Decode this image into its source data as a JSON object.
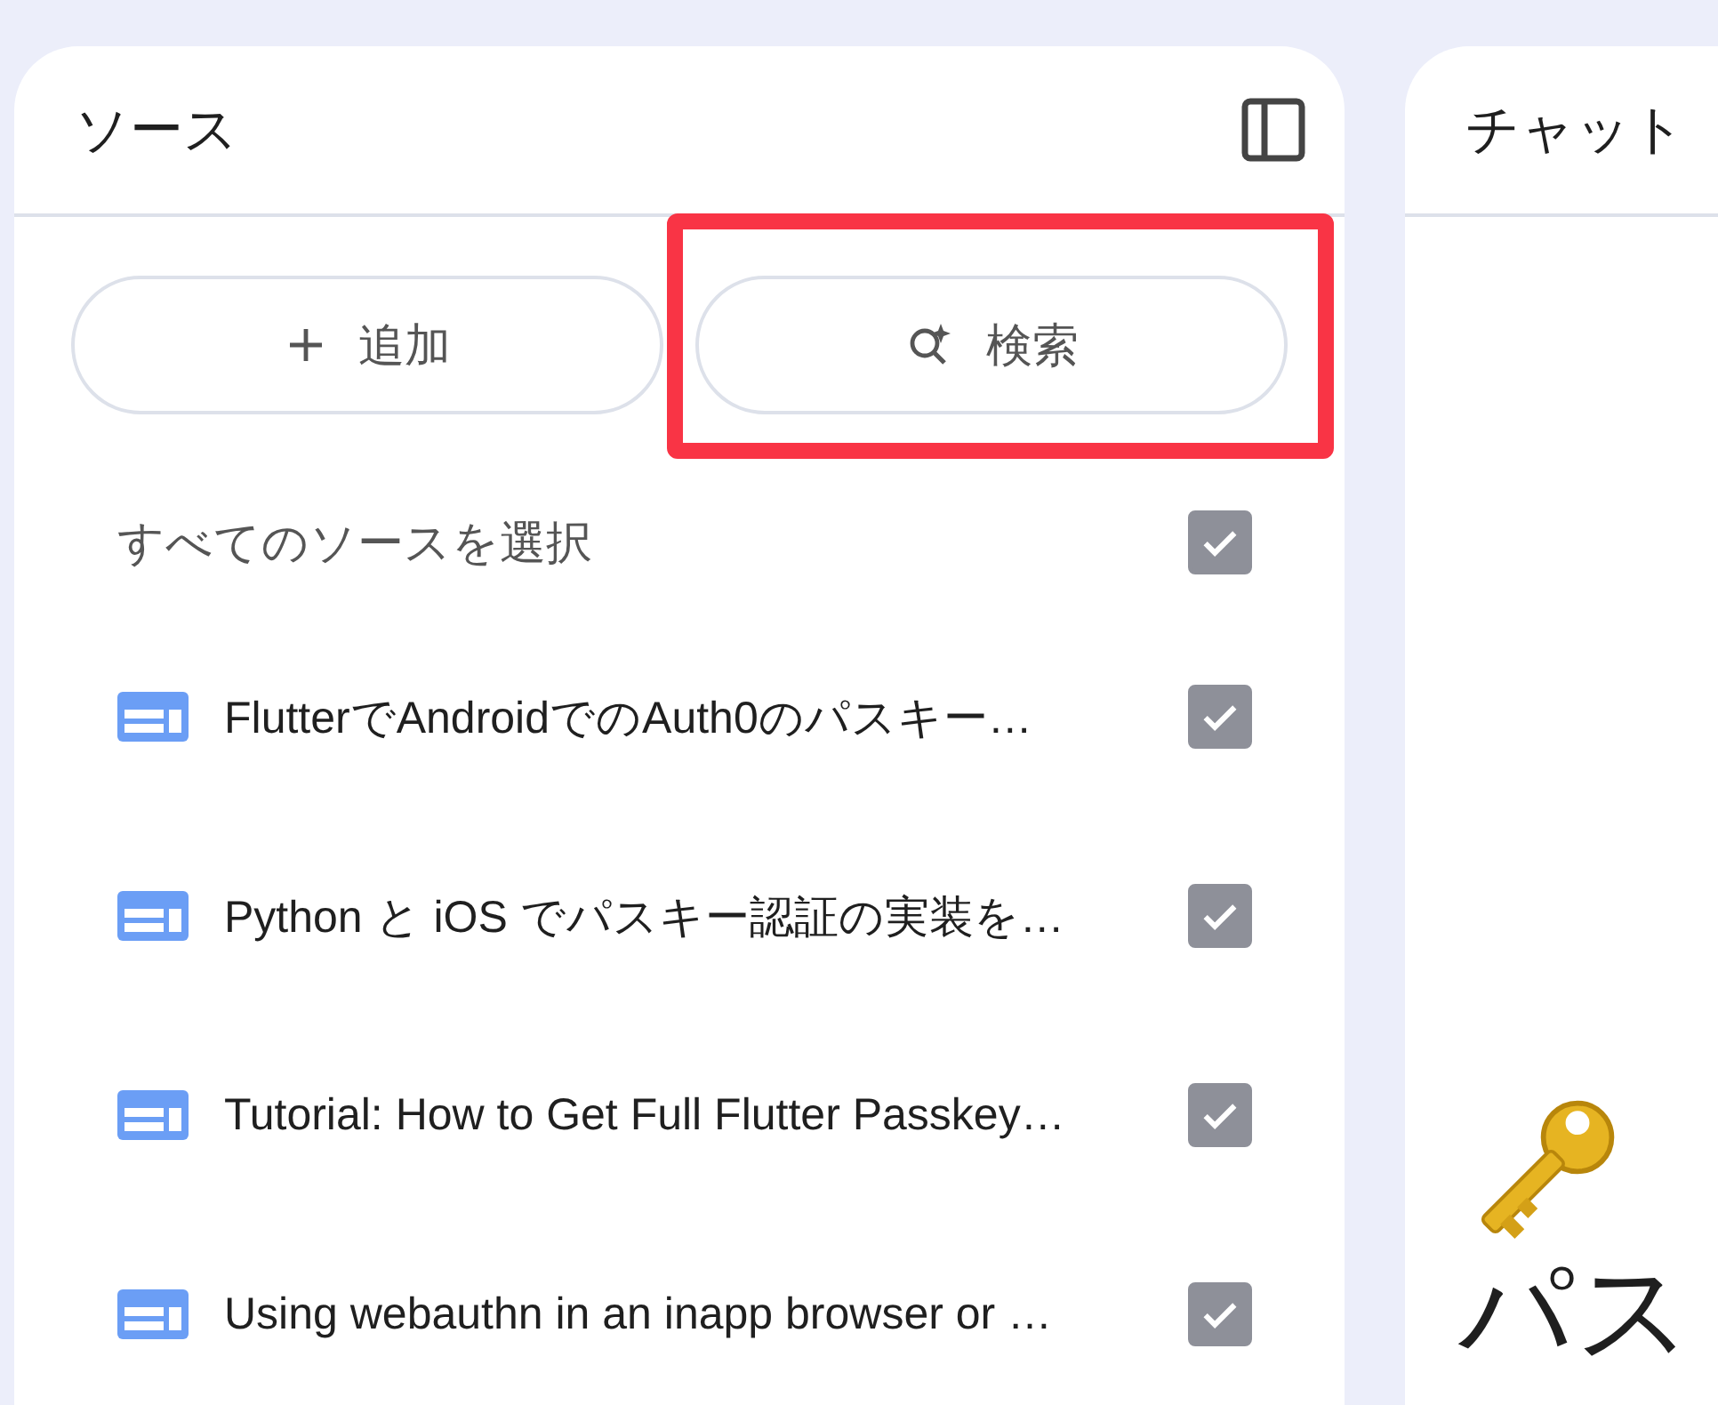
{
  "sources_panel": {
    "title": "ソース",
    "buttons": [
      {
        "kind": "add",
        "label": "追加"
      },
      {
        "kind": "search",
        "label": "検索",
        "highlighted": true
      }
    ],
    "select_all": {
      "label": "すべてのソースを選択",
      "checked": true
    },
    "sources": [
      {
        "title": "FlutterでAndroidでのAuth0のパスキー…",
        "checked": true
      },
      {
        "title": "Python と iOS でパスキー認証の実装を…",
        "checked": true
      },
      {
        "title": "Tutorial: How to Get Full Flutter Passkey…",
        "checked": true
      },
      {
        "title": "Using webauthn in an inapp browser or …",
        "checked": true
      }
    ]
  },
  "chat_panel": {
    "title": "チャット",
    "heading": "パス"
  }
}
